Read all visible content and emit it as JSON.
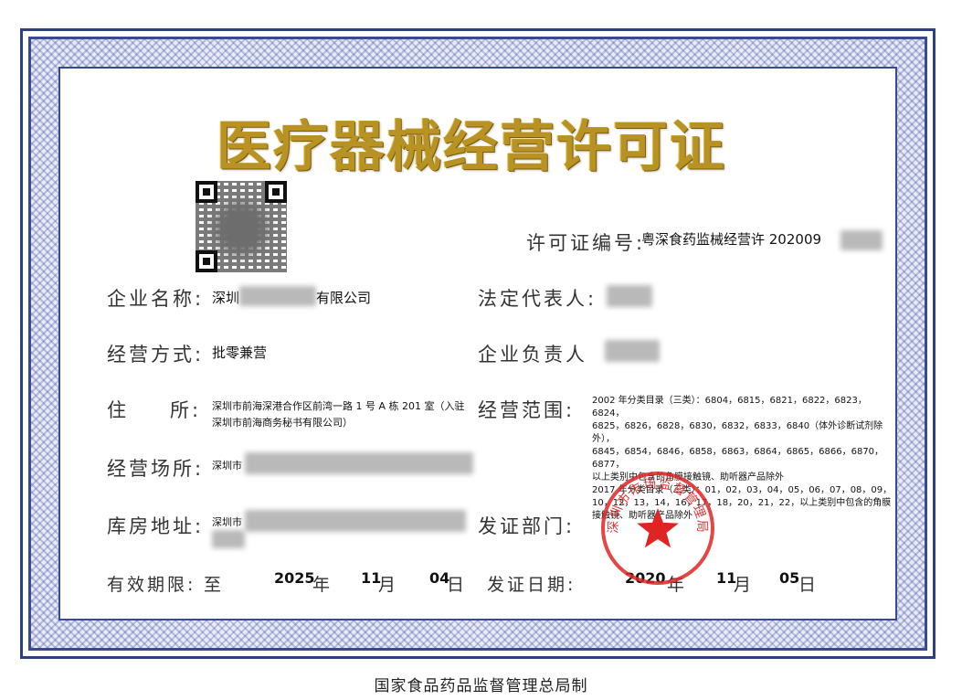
{
  "certificate": {
    "title": "医疗器械经营许可证",
    "license_label": "许可证编号:",
    "license_value": "粤深食药监械经营许 202009",
    "company_label": "企业名称:",
    "company_prefix": "深圳",
    "company_suffix": "有限公司",
    "legal_rep_label": "法定代表人:",
    "mode_label": "经营方式:",
    "mode_value": "批零兼营",
    "person_label": "企业负责人",
    "address_label_1": "住",
    "address_label_2": "所:",
    "address_line1": "深圳市前海深港合作区前湾一路 1 号 A 栋 201 室（入驻",
    "address_line2": "深圳市前海商务秘书有限公司）",
    "scope_label": "经营范围:",
    "scope_lines": [
      "2002 年分类目录（三类）：6804，6815，6821，6822，6823，6824，",
      "6825，6826，6828，6830，6832，6833，6840（体外诊断试剂除外），",
      "6845，6854，6846，6858，6863，6864，6865，6866，6870，6877，",
      "以上类别中包含的角膜接触镜、助听器产品除外",
      "2017 年分类目录（三类）：01，02，03，04，05，06，07，08，09，",
      "10，12，13，14，16，17，18，20，21，22，以上类别中包含的角膜",
      "接触镜、助听器产品除外"
    ],
    "premises_label": "经营场所:",
    "premises_value": "深圳市",
    "warehouse_label": "库房地址:",
    "warehouse_value": "深圳市",
    "issuer_label": "发证部门:",
    "validity_label": "有效期限:",
    "validity_prefix": "至",
    "valid_year": "2025",
    "valid_month": "11",
    "valid_day": "04",
    "year_unit": "年",
    "month_unit": "月",
    "day_unit": "日",
    "issue_label": "发证日期:",
    "issue_year": "2020",
    "issue_month": "11",
    "issue_day": "05",
    "seal_text": "深圳市市场监督管理局"
  },
  "footer": "国家食品药品监督管理总局制",
  "colors": {
    "border": "#2f3f84",
    "title_gold": "#b89324",
    "seal_red": "#df2424"
  }
}
